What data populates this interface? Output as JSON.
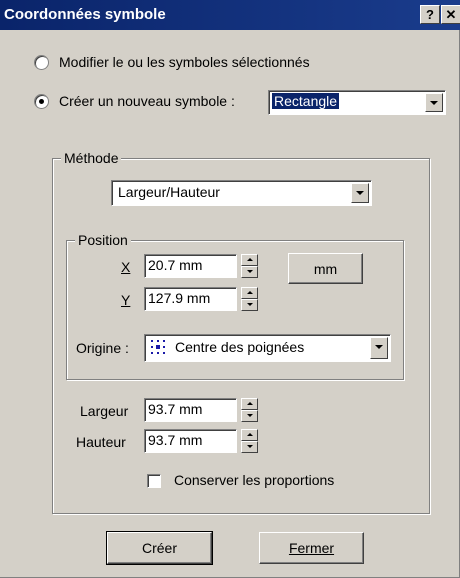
{
  "window": {
    "title": "Coordonnées symbole",
    "help_glyph": "?",
    "close_glyph": "✕"
  },
  "mode": {
    "modify_label": "Modifier le ou les symboles sélectionnés",
    "create_label": "Créer un nouveau symbole :",
    "selected": "create",
    "shape_value": "Rectangle"
  },
  "method": {
    "group_label": "Méthode",
    "value": "Largeur/Hauteur"
  },
  "position": {
    "group_label": "Position",
    "x_label": "X",
    "x_value": "20.7 mm",
    "y_label": "Y",
    "y_value": "127.9 mm",
    "unit_button": "mm",
    "origin_label": "Origine :",
    "origin_value": "Centre des poignées"
  },
  "size": {
    "width_label": "Largeur",
    "width_value": "93.7 mm",
    "height_label": "Hauteur",
    "height_value": "93.7 mm",
    "keep_ratio_label": "Conserver les proportions",
    "keep_ratio_checked": false
  },
  "buttons": {
    "create": "Créer",
    "close": "Fermer"
  },
  "colors": {
    "titlebar": "#0a246a",
    "face": "#d4d0c8",
    "selection": "#0a246a"
  }
}
